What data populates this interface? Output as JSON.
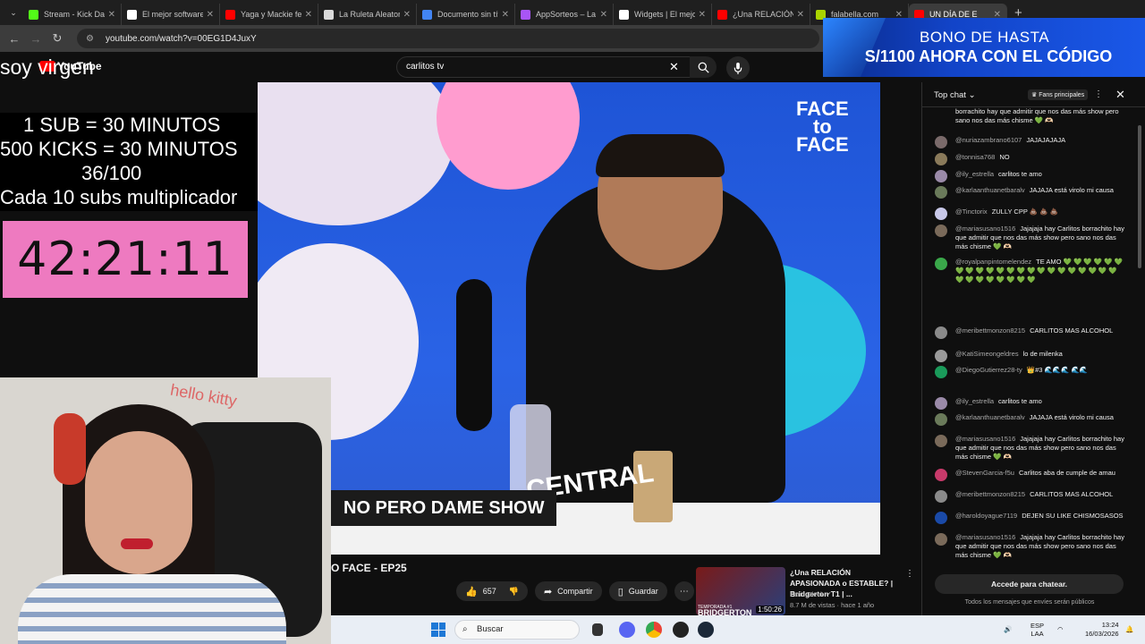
{
  "browser": {
    "tabs": [
      {
        "title": "Stream - Kick Das",
        "color": "#53fc18"
      },
      {
        "title": "El mejor software",
        "color": "#ffffff"
      },
      {
        "title": "Yaga y Mackie fea",
        "color": "#ff0000"
      },
      {
        "title": "La Ruleta Aleator",
        "color": "#d9d9d9"
      },
      {
        "title": "Documento sin tít",
        "color": "#4285f4"
      },
      {
        "title": "AppSorteos – La",
        "color": "#a855f7"
      },
      {
        "title": "Widgets | El mejo",
        "color": "#ffffff"
      },
      {
        "title": "¿Una RELACIÓN",
        "color": "#ff0000"
      },
      {
        "title": "falabella.com",
        "color": "#aad400"
      },
      {
        "title": "UN DÍA DE E",
        "color": "#ff0000"
      }
    ],
    "url": "youtube.com/watch?v=00EG1D4JuxY"
  },
  "ad": {
    "line1": "BONO DE HASTA",
    "line2": "S/1100 AHORA CON EL CÓDIGO"
  },
  "youtube": {
    "logo_text": "YouTube",
    "search_value": "carlitos tv"
  },
  "overlay": {
    "title": "soy virgen",
    "rules": [
      "1 SUB     = 30 MINUTOS",
      "500 KICKS = 30 MINUTOS",
      "36/100",
      "Cada 10 subs multiplicador"
    ],
    "timer": "42:21:11"
  },
  "video": {
    "caption": "NO PERO DAME SHOW",
    "brand": "FACE to FACE",
    "title": "O FACE - EP25",
    "likes": "657",
    "share_label": "Compartir",
    "save_label": "Guardar"
  },
  "recommended": {
    "title": "¿Una RELACIÓN APASIONADA o ESTABLE? | Bridgerton T1 | ...",
    "channel": "Farid Dieck",
    "meta": "8.7 M de vistas · hace 1 año",
    "duration": "1:50:26",
    "thumb_tag": "TEMPORADA #1",
    "thumb_brand": "BRIDGERTON"
  },
  "chat": {
    "mode": "Top chat",
    "fans_label": "Fans principales",
    "messages": [
      {
        "author": "",
        "text": "borrachito hay que admitir que nos das más show pero sano nos das más chisme 💚 🫶🏻",
        "avatar": "#4a5a3a"
      },
      {
        "author": "@nuriazambrano6107",
        "text": "JAJAJAJAJA",
        "avatar": "#7a6a6a"
      },
      {
        "author": "@tonnisa768",
        "text": "NO",
        "avatar": "#8a7a5a"
      },
      {
        "author": "@ily_estrella",
        "text": "carlitos te amo",
        "avatar": "#9a8aa8"
      },
      {
        "author": "@karlaanthuanetbaralv",
        "text": "JAJAJA está virolo mi causa",
        "avatar": "#6a7a5a"
      },
      {
        "author": "@Tinctorix",
        "text": "ZULLY CPP 💩 💩 💩",
        "avatar": "#c8c8e8"
      },
      {
        "author": "@mariasusano1516",
        "text": "Jajajaja hay Carlitos borrachito hay que admitir que nos das más show pero sano nos das más chisme 💚 🫶🏻",
        "avatar": "#7a6a5a"
      },
      {
        "author": "@royalpanpintomelendez",
        "text": "TE AMO 💚 💚 💚 💚 💚 💚 💚 💚 💚 💚 💚 💚 💚 💚 💚 💚 💚 💚 💚 💚 💚 💚 💚 💚 💚 💚 💚 💚 💚 💚",
        "avatar": "#3aa84a"
      },
      {
        "author": "@meribettmonzon8215",
        "text": "CARLITOS MAS ALCOHOL",
        "avatar": "#8a8a8a"
      },
      {
        "author": "@KatiSimeongeldres",
        "text": "lo de milenka",
        "avatar": "#9a9a9a"
      },
      {
        "author": "@DiegoGutierrez28-ty",
        "text": "👑#3  🌊🌊🌊 🌊🌊",
        "avatar": "#1a9a5a"
      },
      {
        "author": "@ily_estrella",
        "text": "carlitos te amo",
        "avatar": "#9a8aa8"
      },
      {
        "author": "@karlaanthuanetbaralv",
        "text": "JAJAJA está virolo mi causa",
        "avatar": "#6a7a5a"
      },
      {
        "author": "@mariasusano1516",
        "text": "Jajajaja hay Carlitos borrachito hay que admitir que nos das más show pero sano nos das más chisme 💚 🫶🏻",
        "avatar": "#7a6a5a"
      },
      {
        "author": "@StevenGarcia-f5u",
        "text": "Carlitos aba de cumple de amau",
        "avatar": "#c83a6a"
      },
      {
        "author": "@meribettmonzon8215",
        "text": "CARLITOS MAS ALCOHOL",
        "avatar": "#8a8a8a"
      },
      {
        "author": "@haroldoyague7119",
        "text": "DEJEN SU LIKE CHISMOSASOS",
        "avatar": "#1a4aa8"
      },
      {
        "author": "@mariasusano1516",
        "text": "Jajajaja hay Carlitos borrachito hay que admitir que nos das más show pero sano nos das más chisme 💚 🫶🏻",
        "avatar": "#7a6a5a"
      }
    ],
    "input_label": "Accede para chatear.",
    "note": "Todos los mensajes que envíes serán públicos"
  },
  "taskbar": {
    "search_placeholder": "Buscar",
    "lang_top": "ESP",
    "lang_bottom": "LAA",
    "time": "13:24",
    "date": "16/03/2026"
  }
}
